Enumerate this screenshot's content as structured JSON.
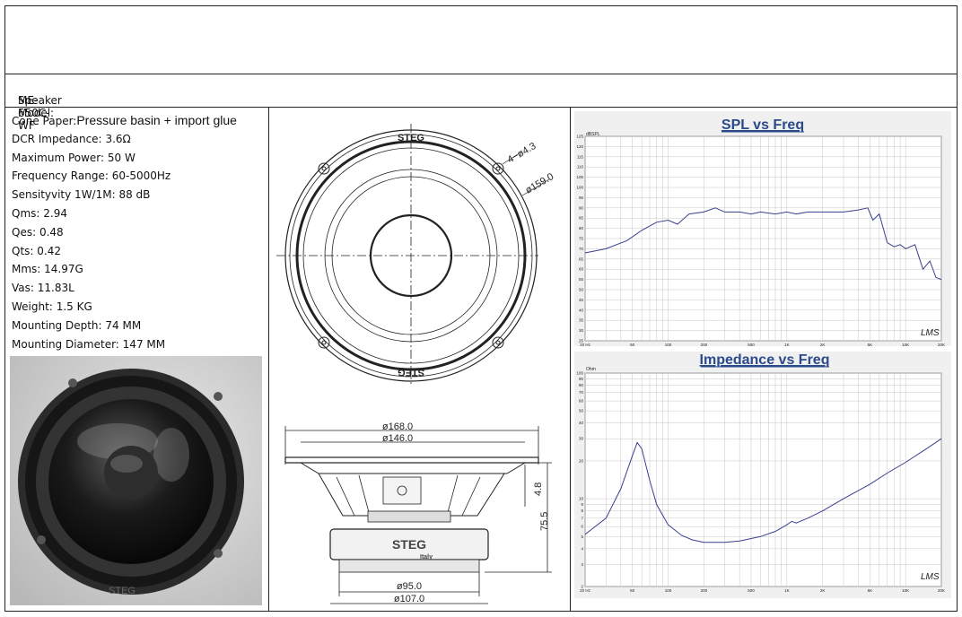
{
  "model": {
    "label": "Speaker Model:",
    "value": "ME-650C-WF"
  },
  "specs": [
    {
      "label": "Cone Paper:",
      "value": "Pressure basin + import glue"
    },
    {
      "label": "DCR Impedance:",
      "value": "3.6Ω"
    },
    {
      "label": "Maximum Power:",
      "value": "50 W"
    },
    {
      "label": "Frequency Range:",
      "value": "60-5000Hz"
    },
    {
      "label": "Sensityvity 1W/1M:",
      "value": "88 dB"
    },
    {
      "label": "Qms:",
      "value": "2.94"
    },
    {
      "label": "Qes:",
      "value": "0.48"
    },
    {
      "label": "Qts:",
      "value": "0.42"
    },
    {
      "label": "Mms:",
      "value": "14.97G"
    },
    {
      "label": "Vas:",
      "value": "11.83L"
    },
    {
      "label": "Weight:",
      "value": "1.5 KG"
    },
    {
      "label": "Mounting Depth:",
      "value": "74 MM"
    },
    {
      "label": "Mounting Diameter:",
      "value": "147 MM"
    }
  ],
  "drawing": {
    "brand": "STEG",
    "brand_sub": "Italy",
    "holes": "4−ø4.3",
    "bolt_circle": "ø159.0",
    "outer_diameter": "ø168.0",
    "frame_diameter": "ø146.0",
    "magnet_diameter": "ø95.0",
    "base_diameter": "ø107.0",
    "flange_thickness": "4.8",
    "depth": "75.5"
  },
  "spl_chart": {
    "title": "SPL vs Freq",
    "unit": "dBSPL",
    "watermark": "LMS",
    "y_ticks": [
      "125",
      "120",
      "115",
      "110",
      "105",
      "100",
      "95",
      "90",
      "85",
      "80",
      "75",
      "70",
      "65",
      "60",
      "55",
      "50",
      "45",
      "40",
      "35",
      "30",
      "25"
    ],
    "x_ticks": [
      "20 Hz",
      "50",
      "100",
      "200",
      "500",
      "1K",
      "2K",
      "5K",
      "10K",
      "20K"
    ]
  },
  "imp_chart": {
    "title": "Impedance vs Freq",
    "unit": "Ohm",
    "watermark": "LMS",
    "y_ticks": [
      "100",
      "90",
      "80",
      "70",
      "60",
      "50",
      "40",
      "30",
      "20",
      "10",
      "9",
      "8",
      "7",
      "6",
      "5",
      "4",
      "3",
      "2"
    ],
    "x_ticks": [
      "20 Hz",
      "50",
      "100",
      "200",
      "500",
      "1K",
      "2K",
      "5K",
      "10K",
      "20K"
    ]
  },
  "colors": {
    "curve": "#3a3f8f",
    "title": "#2a4a8a",
    "grid": "#b9b9b9",
    "border": "#222222"
  }
}
